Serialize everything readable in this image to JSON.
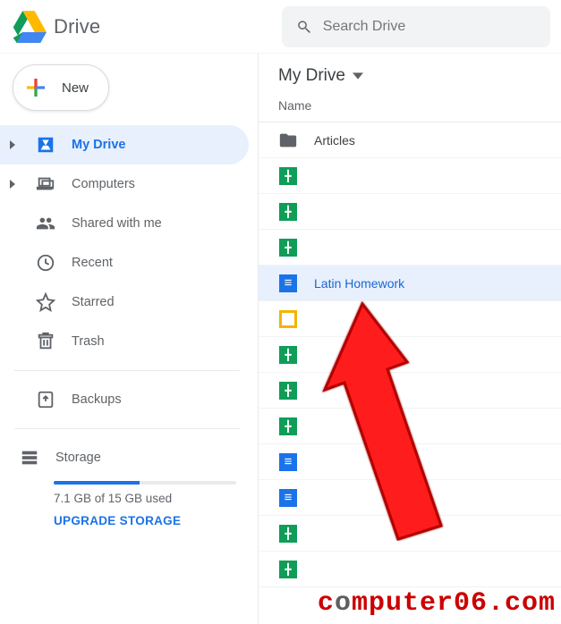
{
  "header": {
    "app_title": "Drive",
    "search_placeholder": "Search Drive"
  },
  "sidebar": {
    "new_label": "New",
    "items": [
      {
        "label": "My Drive"
      },
      {
        "label": "Computers"
      },
      {
        "label": "Shared with me"
      },
      {
        "label": "Recent"
      },
      {
        "label": "Starred"
      },
      {
        "label": "Trash"
      }
    ],
    "backups_label": "Backups",
    "storage_label": "Storage",
    "storage_used_text": "7.1 GB of 15 GB used",
    "storage_fraction_pct": "47%",
    "upgrade_label": "UPGRADE STORAGE"
  },
  "main": {
    "folder_title": "My Drive",
    "column_label": "Name",
    "files": [
      {
        "type": "folder",
        "label": "Articles"
      },
      {
        "type": "sheet",
        "label": ""
      },
      {
        "type": "sheet",
        "label": ""
      },
      {
        "type": "sheet",
        "label": ""
      },
      {
        "type": "doc",
        "label": "Latin Homework",
        "selected": true
      },
      {
        "type": "slide",
        "label": ""
      },
      {
        "type": "sheet",
        "label": ""
      },
      {
        "type": "sheet",
        "label": ""
      },
      {
        "type": "sheet",
        "label": ""
      },
      {
        "type": "doc",
        "label": ""
      },
      {
        "type": "doc",
        "label": ""
      },
      {
        "type": "sheet",
        "label": ""
      },
      {
        "type": "sheet",
        "label": ""
      }
    ]
  },
  "watermark": {
    "text_a": "c",
    "text_o": "o",
    "text_b": "mputer06.com"
  }
}
